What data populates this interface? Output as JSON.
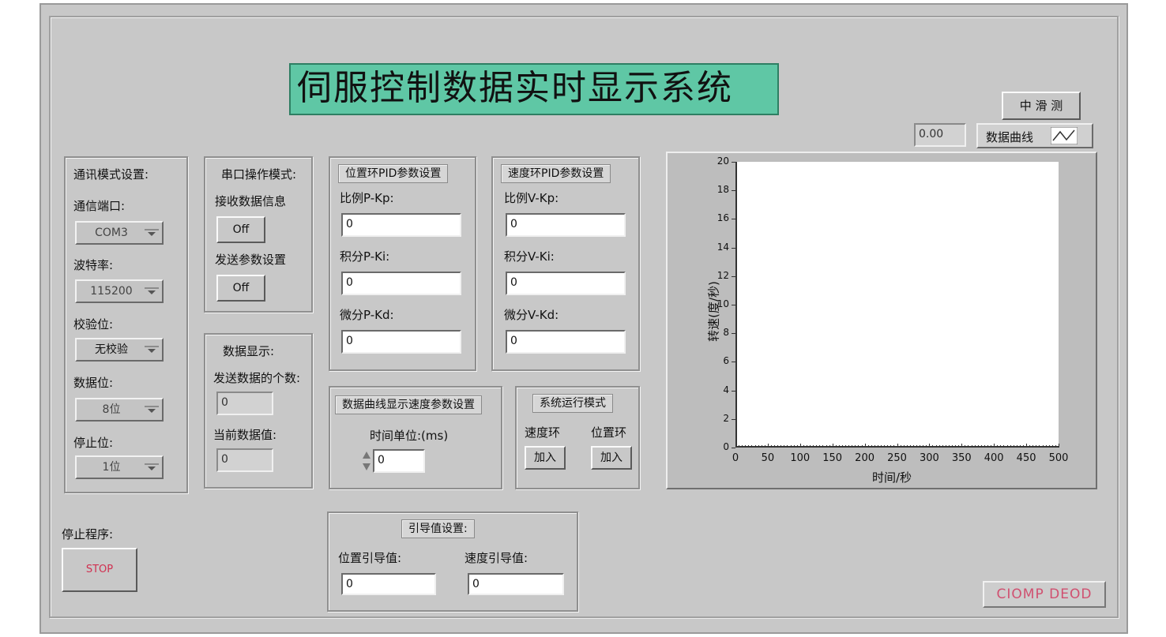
{
  "title": "伺服控制数据实时显示系统",
  "comm": {
    "heading": "通讯模式设置:",
    "port_label": "通信端口:",
    "port_value": "COM3",
    "baud_label": "波特率:",
    "baud_value": "115200",
    "parity_label": "校验位:",
    "parity_value": "无校验",
    "databits_label": "数据位:",
    "databits_value": "8位",
    "stopbits_label": "停止位:",
    "stopbits_value": "1位"
  },
  "serial": {
    "heading": "串口操作模式:",
    "receive_label": "接收数据信息",
    "receive_btn": "Off",
    "send_label": "发送参数设置",
    "send_btn": "Off"
  },
  "display": {
    "heading": "数据显示:",
    "sent_count_label": "发送数据的个数:",
    "sent_count_value": "0",
    "current_label": "当前数据值:",
    "current_value": "0"
  },
  "pos_pid": {
    "heading": "位置环PID参数设置",
    "kp_label": "比例P-Kp:",
    "kp_value": "0",
    "ki_label": "积分P-Ki:",
    "ki_value": "0",
    "kd_label": "微分P-Kd:",
    "kd_value": "0"
  },
  "vel_pid": {
    "heading": "速度环PID参数设置",
    "kp_label": "比例V-Kp:",
    "kp_value": "0",
    "ki_label": "积分V-Ki:",
    "ki_value": "0",
    "kd_label": "微分V-Kd:",
    "kd_value": "0"
  },
  "curve_speed": {
    "heading": "数据曲线显示速度参数设置",
    "unit_label": "时间单位:(ms)",
    "unit_value": "0"
  },
  "run_mode": {
    "heading": "系统运行模式",
    "vel_label": "速度环",
    "vel_btn": "加入",
    "pos_label": "位置环",
    "pos_btn": "加入"
  },
  "stop": {
    "label": "停止程序:",
    "btn": "STOP"
  },
  "guide": {
    "heading": "引导值设置:",
    "pos_label": "位置引导值:",
    "pos_value": "0",
    "vel_label": "速度引导值:",
    "vel_value": "0"
  },
  "chart_header": {
    "toolbar_label": "中 滑 测",
    "cursor_value": "0.00",
    "legend_label": "数据曲线"
  },
  "logo": "CIOMP DEOD",
  "chart_data": {
    "type": "line",
    "title": "",
    "xlabel": "时间/秒",
    "ylabel": "转速(度/秒)",
    "xlim": [
      0,
      500
    ],
    "ylim": [
      0,
      20
    ],
    "x_ticks": [
      "0",
      "50",
      "100",
      "150",
      "200",
      "250",
      "300",
      "350",
      "400",
      "450",
      "500"
    ],
    "y_ticks": [
      "0",
      "2",
      "4",
      "6",
      "8",
      "10",
      "12",
      "14",
      "16",
      "18",
      "20"
    ],
    "series": [
      {
        "name": "数据曲线",
        "x": [],
        "y": []
      }
    ],
    "grid": false
  }
}
